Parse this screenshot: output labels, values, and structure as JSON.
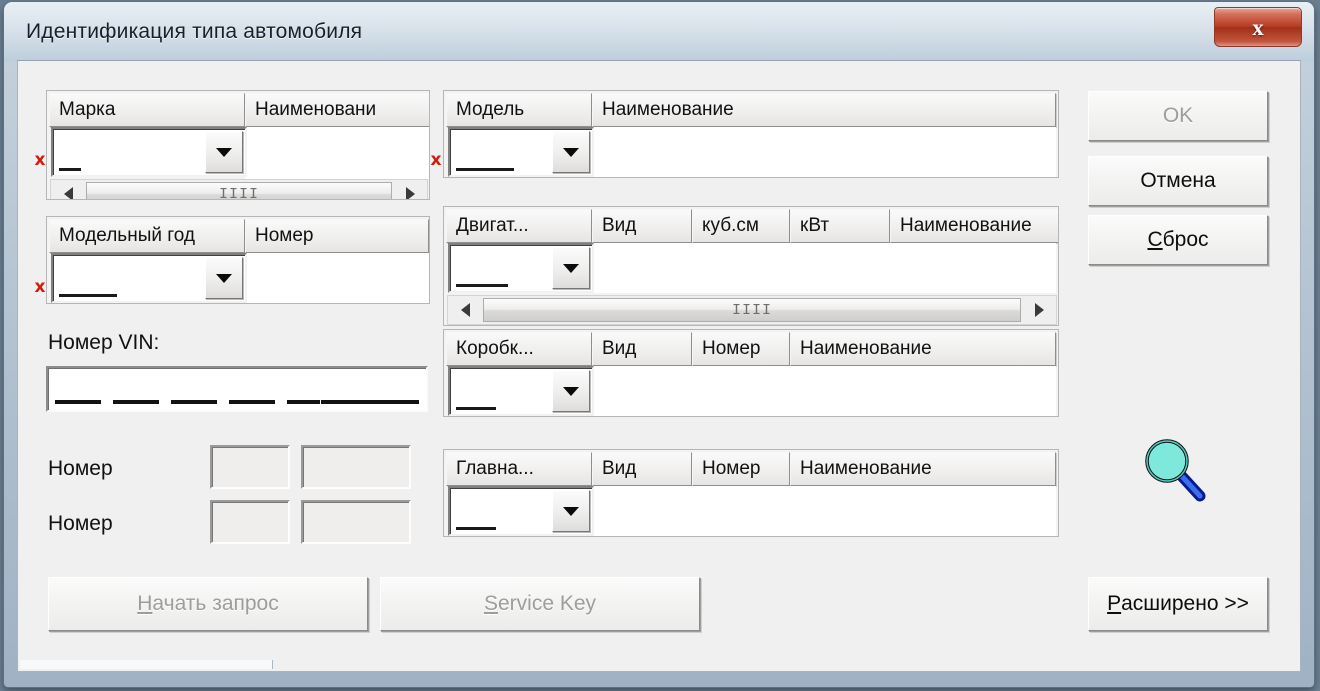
{
  "window": {
    "title": "Идентификация типа автомобиля",
    "close_label": "x",
    "close_icon": "close-icon"
  },
  "left_panel": {
    "brand_group": {
      "headers": [
        "Марка",
        "Наименовани"
      ],
      "combo_value": "",
      "scroll_grip": "IIII"
    },
    "model_year_group": {
      "headers": [
        "Модельный год",
        "Номер"
      ],
      "combo_value": ""
    }
  },
  "vin": {
    "label": "Номер VIN:",
    "value": "",
    "placeholder": ""
  },
  "number_rows": [
    {
      "label": "Номер",
      "value_a": "",
      "value_b": ""
    },
    {
      "label": "Номер",
      "value_a": "",
      "value_b": ""
    }
  ],
  "middle_panel": {
    "model_group": {
      "headers": [
        "Модель",
        "Наименование"
      ],
      "combo_value": ""
    },
    "engine_group": {
      "headers": [
        "Двигат...",
        "Вид",
        "куб.см",
        "кВт",
        "Наименование"
      ],
      "combo_value": "",
      "scroll_grip": "IIII"
    },
    "gearbox_group": {
      "headers": [
        "Коробк...",
        "Вид",
        "Номер",
        "Наименование"
      ],
      "combo_value": ""
    },
    "maindrive_group": {
      "headers": [
        "Главна...",
        "Вид",
        "Номер",
        "Наименование"
      ],
      "combo_value": ""
    }
  },
  "right_buttons": {
    "ok": {
      "label": "OK",
      "enabled": false
    },
    "cancel": {
      "label": "Отмена",
      "enabled": true
    },
    "reset": {
      "label": "Сброс",
      "accel": "С",
      "rest": "брос",
      "enabled": true
    },
    "search_icon": "magnifier-icon"
  },
  "bottom_buttons": {
    "start_query": {
      "accel": "Н",
      "rest": "ачать запрос",
      "enabled": false
    },
    "service_key": {
      "accel": "S",
      "rest": "ervice Key",
      "enabled": false
    },
    "extended": {
      "accel": "Р",
      "rest": "асширено >>",
      "enabled": true
    }
  },
  "required_markers": [
    "x",
    "x",
    "x"
  ],
  "colors": {
    "accent_close": "#b53a22",
    "required": "#d8180f",
    "magnifier_lens": "#7fe8dd",
    "magnifier_handle": "#1f3fd0",
    "title_bg": "#dce5ed",
    "client_bg": "#eff0ef"
  }
}
